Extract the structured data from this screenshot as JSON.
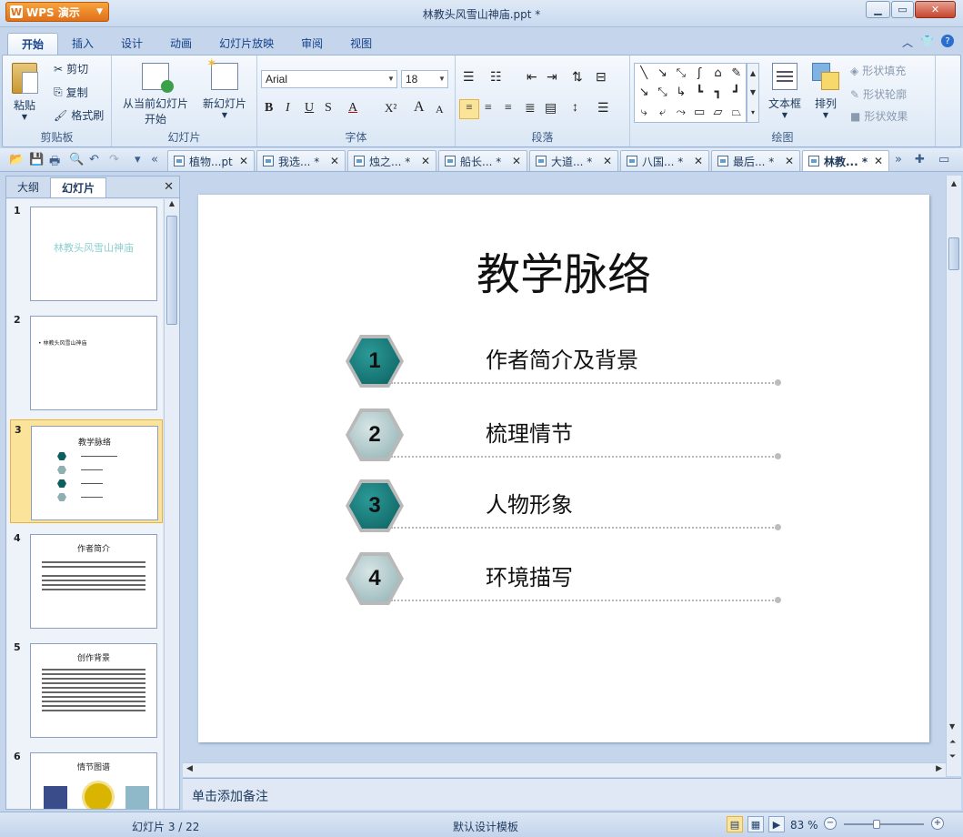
{
  "app": {
    "name": "WPS 演示",
    "title": "林教头风雪山神庙.ppt *"
  },
  "ribbon_tabs": [
    "开始",
    "插入",
    "设计",
    "动画",
    "幻灯片放映",
    "审阅",
    "视图"
  ],
  "clipboard": {
    "paste": "粘贴",
    "cut": "剪切",
    "copy": "复制",
    "format_painter": "格式刷",
    "label": "剪贴板"
  },
  "slides_group": {
    "from_current_line1": "从当前幻灯片",
    "from_current_line2": "开始",
    "new_slide": "新幻灯片",
    "label": "幻灯片"
  },
  "font_group": {
    "font": "Arial",
    "size": "18",
    "label": "字体",
    "bold": "B",
    "italic": "I",
    "underline": "U",
    "shadow": "S",
    "font_color": "A",
    "superscript": "X²",
    "grow": "A",
    "shrink": "A"
  },
  "paragraph_group": {
    "label": "段落"
  },
  "drawing_group": {
    "textbox": "文本框",
    "arrange": "排列",
    "shape_fill": "形状填充",
    "shape_outline": "形状轮廓",
    "shape_effects": "形状效果",
    "label": "绘图"
  },
  "doc_tabs": [
    "植物...pt",
    "我选... *",
    "烛之... *",
    "船长... *",
    "大道... *",
    "八国... *",
    "最后... *",
    "林教... *"
  ],
  "left_panel": {
    "tab_outline": "大纲",
    "tab_slides": "幻灯片"
  },
  "thumbnails": [
    {
      "num": "1",
      "title": "林教头风雪山神庙",
      "title_color": "#8ecfcf"
    },
    {
      "num": "2",
      "title": "• 林教头风雪山神庙"
    },
    {
      "num": "3",
      "title": "教学脉络"
    },
    {
      "num": "4",
      "title": "作者简介"
    },
    {
      "num": "5",
      "title": "创作背景"
    },
    {
      "num": "6",
      "title": "情节图谱"
    }
  ],
  "slide": {
    "title": "教学脉络",
    "items": [
      {
        "num": "1",
        "text": "作者简介及背景",
        "style": "teal"
      },
      {
        "num": "2",
        "text": "梳理情节",
        "style": "grey"
      },
      {
        "num": "3",
        "text": "人物形象",
        "style": "teal"
      },
      {
        "num": "4",
        "text": "环境描写",
        "style": "grey"
      }
    ]
  },
  "notes": {
    "placeholder": "单击添加备注"
  },
  "status": {
    "slide": "幻灯片 3 / 22",
    "template": "默认设计模板",
    "zoom": "83 %",
    "zoom_level_pct": 83
  },
  "colors": {
    "accent_orange": "#e0701a",
    "teal": "#0b5f5e",
    "selected": "#fbe39a"
  }
}
